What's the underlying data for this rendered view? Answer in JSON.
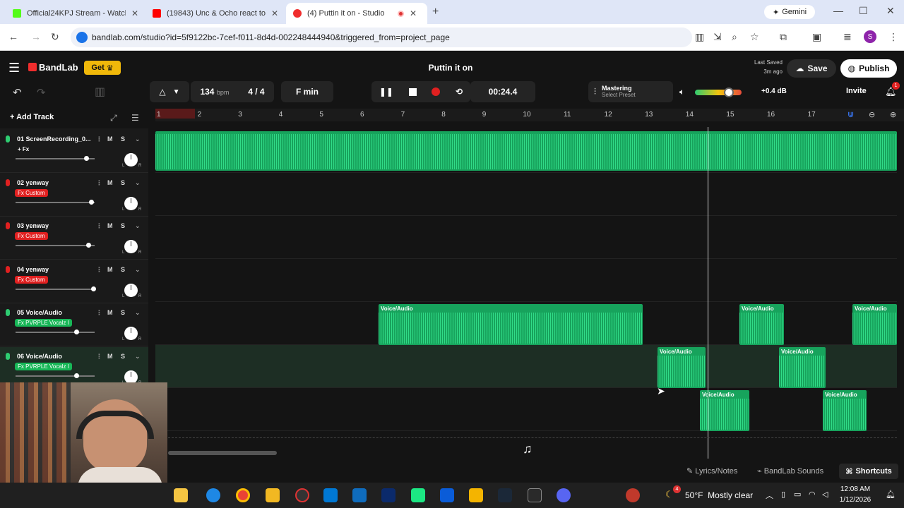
{
  "browser": {
    "tabs": [
      {
        "label": "Official24KPJ Stream - Watch Li",
        "color": "#53fc18"
      },
      {
        "label": "(19843) Unc & Ocho react to Pa",
        "color": "#ff0000"
      },
      {
        "label": "(4) Puttin it on - Studio",
        "color": "#f02d2d"
      }
    ],
    "gemini": "Gemini",
    "url": "bandlab.com/studio?id=5f9122bc-7cef-f011-8d4d-002248444940&triggered_from=project_page",
    "profile_initial": "S"
  },
  "app": {
    "logo": "BandLab",
    "get_label": "Get",
    "project_title": "Puttin it on",
    "last_saved_label": "Last Saved",
    "last_saved_time": "3m ago",
    "save_label": "Save",
    "publish_label": "Publish",
    "invite_label": "Invite",
    "notif_count": "1"
  },
  "toolbar": {
    "bpm": "134",
    "bpm_unit": "bpm",
    "time_sig": "4 / 4",
    "key": "F min",
    "time": "00:24.4",
    "mastering_label": "Mastering",
    "mastering_preset": "Select Preset",
    "volume_db": "+0.4 dB",
    "volume_level": 0.72
  },
  "tracks_panel": {
    "add_track_label": "Add Track",
    "tracks": [
      {
        "name": "01 ScreenRecording_0...",
        "fx": "+ Fx",
        "fx_color": "transparent",
        "mic_color": "#2ecc71",
        "vol": 0.9
      },
      {
        "name": "02 yenway",
        "fx": "Fx Custom",
        "fx_color": "#e02020",
        "mic_color": "#e02020",
        "vol": 0.96
      },
      {
        "name": "03 yenway",
        "fx": "Fx Custom",
        "fx_color": "#e02020",
        "mic_color": "#e02020",
        "vol": 0.93
      },
      {
        "name": "04 yenway",
        "fx": "Fx Custom",
        "fx_color": "#e02020",
        "mic_color": "#e02020",
        "vol": 0.99
      },
      {
        "name": "05 Voice/Audio",
        "fx": "Fx PVRPLE Vocalz I",
        "fx_color": "#17b757",
        "mic_color": "#2ecc71",
        "vol": 0.78
      },
      {
        "name": "06 Voice/Audio",
        "fx": "Fx PVRPLE Vocalz I",
        "fx_color": "#17b757",
        "mic_color": "#2ecc71",
        "vol": 0.78
      }
    ]
  },
  "ruler": [
    "1",
    "2",
    "3",
    "4",
    "5",
    "6",
    "7",
    "8",
    "9",
    "10",
    "11",
    "12",
    "13",
    "14",
    "15",
    "16",
    "17"
  ],
  "clip_label": "Voice/Audio",
  "bottom": {
    "lyrics": "Lyrics/Notes",
    "sounds": "BandLab Sounds",
    "shortcuts": "Shortcuts"
  },
  "taskbar": {
    "weather": "50°F  Mostly clear",
    "weather_badge": "4",
    "time": "12:08 AM",
    "date": "1/12/2026"
  }
}
